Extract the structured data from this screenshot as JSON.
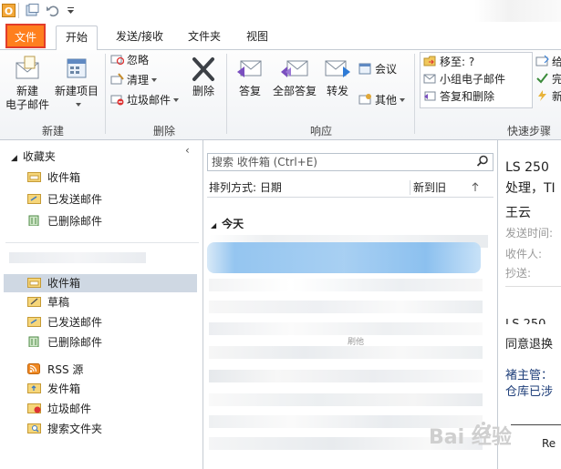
{
  "tabs": {
    "file": "文件",
    "home": "开始",
    "send_receive": "发送/接收",
    "folder": "文件夹",
    "view": "视图"
  },
  "ribbon": {
    "new_group": {
      "label": "新建",
      "new_email_line1": "新建",
      "new_email_line2": "电子邮件",
      "new_items_line1": "新建项目"
    },
    "delete_group": {
      "label": "删除",
      "ignore": "忽略",
      "clean_up": "清理",
      "junk": "垃圾邮件",
      "delete": "删除"
    },
    "respond_group": {
      "label": "响应",
      "reply": "答复",
      "reply_all": "全部答复",
      "forward": "转发",
      "meeting": "会议",
      "more": "其他"
    },
    "quick_steps": {
      "label": "快速步骤",
      "move_to": "移至: ?",
      "team_email": "小组电子邮件",
      "reply_delete": "答复和删除",
      "col2_1": "给",
      "col2_2": "完",
      "col2_3": "新"
    }
  },
  "nav": {
    "favorites_header": "收藏夹",
    "favorites": [
      "收件箱",
      "已发送邮件",
      "已删除邮件"
    ],
    "folders": [
      "收件箱",
      "草稿",
      "已发送邮件",
      "已删除邮件",
      "RSS 源",
      "发件箱",
      "垃圾邮件",
      "搜索文件夹"
    ]
  },
  "list": {
    "search_placeholder": "搜索 收件箱 (Ctrl+E)",
    "sort_label": "排列方式: 日期",
    "order_label": "新到旧",
    "group_header": "今天",
    "fragment": "刷他"
  },
  "reading": {
    "subject_line1": "LS 250",
    "subject_line2": "处理，TI",
    "sender": "王云",
    "sent_label": "发送时间:",
    "to_label": "收件人:",
    "cc_label": "抄送:",
    "body_line1": "LS 250",
    "body_line2": "同意退换",
    "body_line3": "褚主管：",
    "body_line4": "仓库已涉",
    "footer": "Re"
  },
  "watermark": "Bai 经验",
  "colors": {
    "file_tab": "#ff7f1e",
    "selection": "#cfd8e3",
    "highlight_row": "#8fc2ef"
  }
}
